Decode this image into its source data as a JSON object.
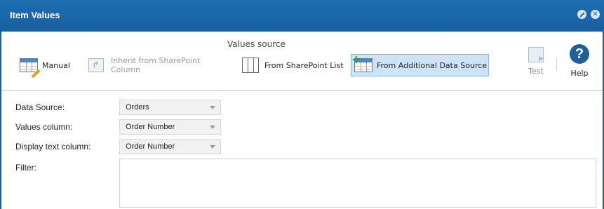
{
  "window": {
    "title": "Item Values"
  },
  "ribbon": {
    "group_label": "Values source",
    "manual": "Manual",
    "inherit": "Inherit from SharePoint Column",
    "sp_list": "From SharePoint List",
    "additional": "From Additional Data Source",
    "test": "Test",
    "help": "Help"
  },
  "form": {
    "data_source": {
      "label": "Data Source:",
      "value": "Orders"
    },
    "values_column": {
      "label": "Values column:",
      "value": "Order Number"
    },
    "display_column": {
      "label": "Display text column:",
      "value": "Order Number"
    },
    "filter": {
      "label": "Filter:",
      "value": ""
    }
  },
  "colors": {
    "titlebar": "#1b67a7",
    "active_button": "#cfe3f7"
  },
  "icons": [
    "minimize-icon",
    "close-icon",
    "table-edit-icon",
    "inherit-column-icon",
    "list-columns-icon",
    "add-data-source-icon",
    "test-icon",
    "help-icon",
    "dropdown-caret-icon"
  ]
}
